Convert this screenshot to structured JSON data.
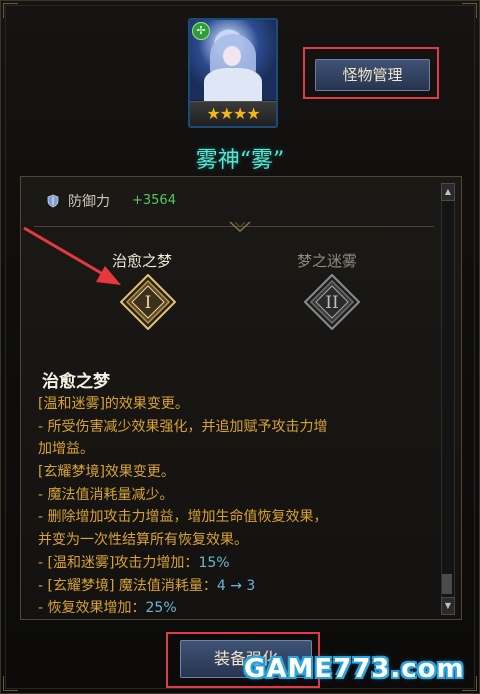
{
  "monster": {
    "name": "雾神“雾”",
    "stars": "★★★★",
    "element_icon": "wind-element-icon"
  },
  "buttons": {
    "monster_manage": "怪物管理",
    "equip_enhance": "装备强化"
  },
  "stat": {
    "icon": "shield-icon",
    "name": "防御力",
    "value": "+3564"
  },
  "tiers": [
    {
      "label": "治愈之梦",
      "numeral": "I",
      "state": "selected"
    },
    {
      "label": "梦之迷雾",
      "numeral": "II",
      "state": "locked"
    }
  ],
  "skill": {
    "title": "治愈之梦",
    "lines": [
      {
        "parts": [
          "[温和迷雾]的效果变更。"
        ]
      },
      {
        "parts": [
          "- 所受伤害减少效果强化，并追加赋予攻击力增"
        ]
      },
      {
        "parts": [
          "加增益。"
        ]
      },
      {
        "parts": [
          "[玄耀梦境]效果变更。"
        ]
      },
      {
        "parts": [
          "- 魔法值消耗量减少。"
        ]
      },
      {
        "parts": [
          "- 删除增加攻击力增益，增加生命值恢复效果，"
        ]
      },
      {
        "parts": [
          "并变为一次性结算所有恢复效果。"
        ]
      },
      {
        "parts": [
          "- [温和迷雾]攻击力增加：",
          "15%"
        ]
      },
      {
        "parts": [
          "- [玄耀梦境] 魔法值消耗量：",
          "4 → 3"
        ]
      },
      {
        "parts": [
          "- 恢复效果增加：",
          "25%"
        ]
      }
    ]
  },
  "watermark": "GAME773.com",
  "colors": {
    "accent_title": "#5be4d2",
    "desc_gold": "#d8a233",
    "value_cyan": "#6fb5d4",
    "stat_green": "#57c85a",
    "highlight_red": "#e03b48"
  }
}
